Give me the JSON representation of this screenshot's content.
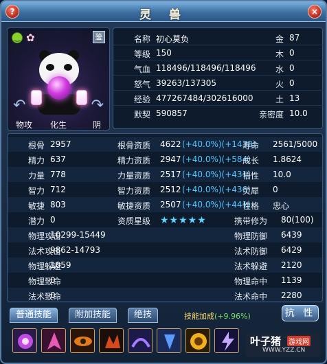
{
  "window": {
    "title": "灵 兽",
    "help_label": "?",
    "close_label": "×"
  },
  "portrait": {
    "jian_label": "鉴",
    "left_label": "物攻",
    "center_label": "化生",
    "right_label": "阴"
  },
  "info": {
    "rows": [
      {
        "label": "名称",
        "value": "初心莫负",
        "label2": "金",
        "value2": "87"
      },
      {
        "label": "等级",
        "value": "150",
        "label2": "木",
        "value2": "0"
      },
      {
        "label": "气血",
        "value": "118496/118496/118496",
        "label2": "水",
        "value2": "0"
      },
      {
        "label": "怒气",
        "value": "39263/137305",
        "label2": "火",
        "value2": "0"
      },
      {
        "label": "经验",
        "value": "477267484/302616000",
        "label2": "土",
        "value2": "13"
      },
      {
        "label": "默契",
        "value": "590857",
        "label2": "亲密度",
        "value2": "10.0"
      }
    ]
  },
  "stats": {
    "rows": [
      {
        "a": "根骨",
        "av": "2957",
        "b": "根骨资质",
        "bv": "4622",
        "bb": "(+40.0%)(+1438)",
        "c": "寿命",
        "cv": "2561/5000"
      },
      {
        "a": "精力",
        "av": "637",
        "b": "精力资质",
        "bv": "2947",
        "bb": "(+40.0%)(+584)",
        "c": "成长",
        "cv": "1.8624"
      },
      {
        "a": "力量",
        "av": "778",
        "b": "力量资质",
        "bv": "2517",
        "bb": "(+40.0%)(+431)",
        "c": "悟性",
        "cv": "10.0"
      },
      {
        "a": "智力",
        "av": "712",
        "b": "智力资质",
        "bv": "2512",
        "bb": "(+40.0%)(+436)",
        "c": "灵犀",
        "cv": "0"
      },
      {
        "a": "敏捷",
        "av": "803",
        "b": "敏捷资质",
        "bv": "2507",
        "bb": "(+40.0%)(+441)",
        "c": "性格",
        "cv": "忠心"
      },
      {
        "a": "潜力",
        "av": "0",
        "b": "资质星级",
        "bv": "★★★★★",
        "bb": "",
        "c": "携带修为",
        "cv": "80(100)"
      },
      {
        "a": "物理攻击",
        "av": "10299-15449",
        "b": "",
        "bv": "",
        "bb": "",
        "c": "物理防御",
        "cv": "6439"
      },
      {
        "a": "法术攻击",
        "av": "9862-14793",
        "b": "",
        "bv": "",
        "bb": "",
        "c": "法术防御",
        "cv": "6429"
      },
      {
        "a": "物理躲避",
        "av": "1059",
        "b": "",
        "bv": "",
        "bb": "",
        "c": "法术躲避",
        "cv": "2120"
      },
      {
        "a": "物理致命",
        "av": "0",
        "b": "",
        "bv": "",
        "bb": "",
        "c": "物理命中",
        "cv": "1139"
      },
      {
        "a": "法术致命",
        "av": "0",
        "b": "",
        "bv": "",
        "bb": "",
        "c": "法术命中",
        "cv": "2280"
      }
    ]
  },
  "tabs": [
    {
      "label": "普通技能",
      "active": true
    },
    {
      "label": "附加技能",
      "active": false
    },
    {
      "label": "绝技",
      "active": false
    }
  ],
  "skill_bonus": {
    "label": "技能加成",
    "value": "(+9.96%)"
  },
  "kang_label": "抗 性",
  "skills": [
    "skill-icon-1",
    "skill-icon-2",
    "skill-icon-3",
    "skill-icon-4",
    "skill-icon-5",
    "skill-icon-6",
    "skill-icon-7",
    "skill-icon-8"
  ],
  "watermark": {
    "name": "叶子猪",
    "tag": "游戏网",
    "url": "WWW.YZZ.CN"
  },
  "colors": {
    "bonus": "#54c6ff",
    "skill_bonus": "#f5d96b",
    "skill_bonus_value": "#7be06a"
  }
}
